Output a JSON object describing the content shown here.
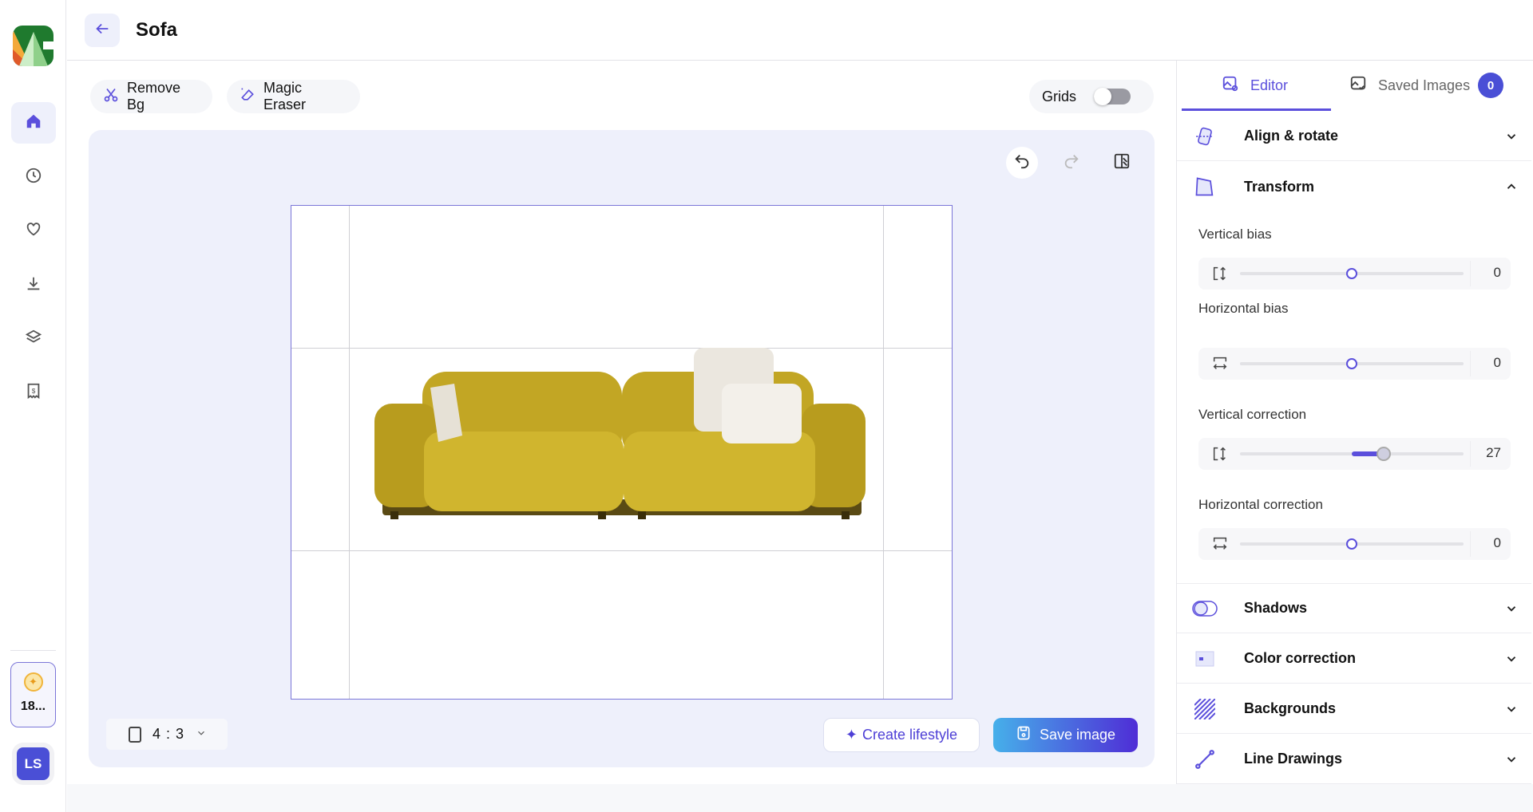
{
  "header": {
    "title": "Sofa"
  },
  "sidebar": {
    "items": [
      "home",
      "history",
      "favorites",
      "downloads",
      "layers",
      "billing"
    ],
    "credits": "18...",
    "avatar": "LS"
  },
  "toolbar": {
    "remove_bg": "Remove Bg",
    "magic_eraser": "Magic Eraser",
    "grids": "Grids",
    "grids_on": false
  },
  "canvas": {
    "aspect": "4 : 3",
    "create_lifestyle": "Create lifestyle",
    "save_image": "Save image"
  },
  "panel": {
    "tabs": [
      {
        "label": "Editor",
        "active": true
      },
      {
        "label": "Saved Images",
        "badge": "0"
      }
    ],
    "sections": {
      "align": "Align & rotate",
      "transform": "Transform",
      "shadows": "Shadows",
      "color": "Color correction",
      "backgrounds": "Backgrounds",
      "line": "Line Drawings"
    },
    "sliders": [
      {
        "label": "Vertical bias",
        "value": "0",
        "num": 0
      },
      {
        "label": "Horizontal bias",
        "value": "0",
        "num": 0
      },
      {
        "label": "Vertical correction",
        "value": "27",
        "num": 27
      },
      {
        "label": "Horizontal correction",
        "value": "0",
        "num": 0
      }
    ],
    "slider_range": [
      -100,
      100
    ]
  },
  "colors": {
    "accent": "#5b4fdc",
    "canvas_bg": "#eef0fb",
    "sofa": "#c9b22a"
  }
}
